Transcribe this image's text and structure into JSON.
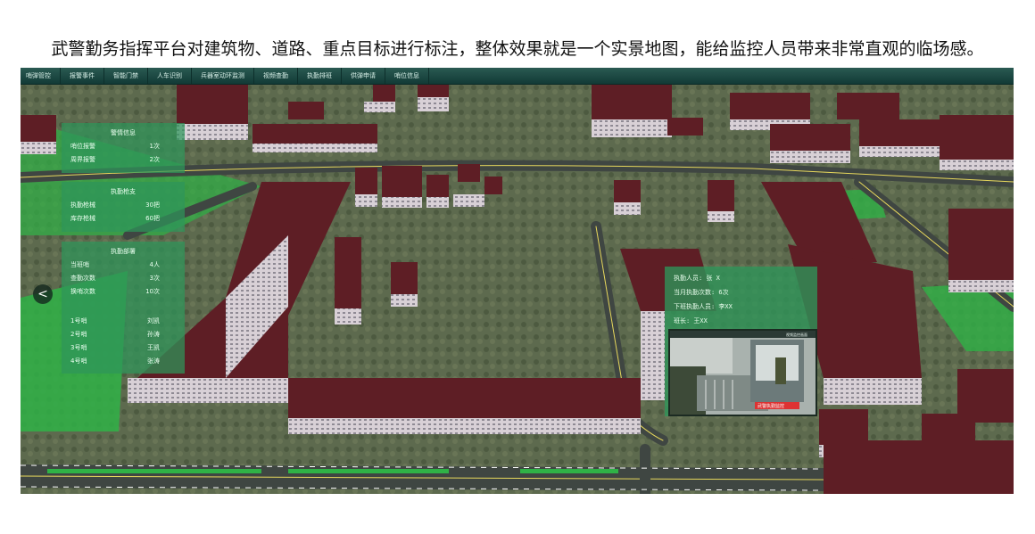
{
  "caption": "武警勤务指挥平台对建筑物、道路、重点目标进行标注，整体效果就是一个实景地图，能给监控人员带来非常直观的临场感。",
  "nav": [
    {
      "label": "哨弹管控"
    },
    {
      "label": "报警事件"
    },
    {
      "label": "智能门禁"
    },
    {
      "label": "人车识别"
    },
    {
      "label": "兵器室动环监测"
    },
    {
      "label": "视频查勤"
    },
    {
      "label": "执勤排班"
    },
    {
      "label": "供弹申请"
    },
    {
      "label": "哨位信息"
    }
  ],
  "alarm_panel": {
    "title": "警情信息",
    "rows": [
      {
        "k": "哨位报警",
        "v": "1次"
      },
      {
        "k": "周界报警",
        "v": "2次"
      }
    ]
  },
  "weapon_panel": {
    "title": "执勤枪支",
    "rows": [
      {
        "k": "执勤枪械",
        "v": "30把"
      },
      {
        "k": "库存枪械",
        "v": "60把"
      }
    ]
  },
  "duty_panel": {
    "title": "执勤部署",
    "rows": [
      {
        "k": "当班哨",
        "v": "4人"
      },
      {
        "k": "查勤次数",
        "v": "3次"
      },
      {
        "k": "换哨次数",
        "v": "10次"
      }
    ],
    "posts": [
      {
        "k": "1号哨",
        "v": "刘凯"
      },
      {
        "k": "2号哨",
        "v": "孙涛"
      },
      {
        "k": "3号哨",
        "v": "王凯"
      },
      {
        "k": "4号哨",
        "v": "张涛"
      }
    ]
  },
  "post_info": {
    "lines": [
      "执勤人员: 张 X",
      "当月执勤次数: 6次",
      "下班执勤人员: 李XX",
      "班长: 王XX"
    ],
    "video_title": "视频监控画面",
    "video_overlay": "武警执勤监控"
  },
  "prev_arrow": "<"
}
